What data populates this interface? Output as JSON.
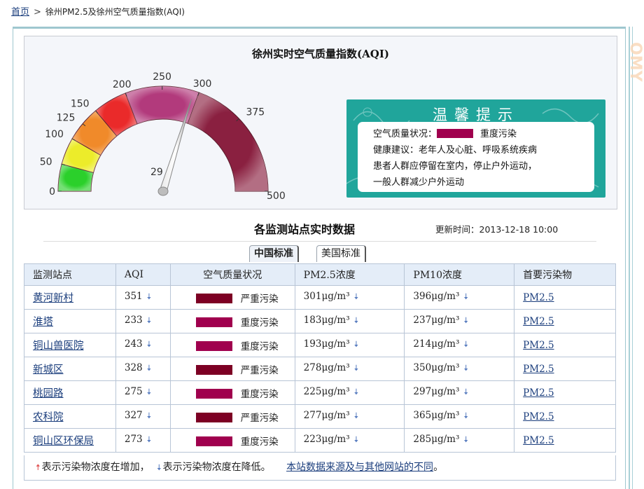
{
  "breadcrumb": {
    "home": "首页",
    "separator": ">",
    "current": "徐州PM2.5及徐州空气质量指数(AQI)"
  },
  "watermark": "OMY",
  "gauge": {
    "title": "徐州实时空气质量指数(AQI)",
    "value_label": "29",
    "needle_value": 293,
    "range": [
      0,
      500
    ],
    "tick_labels": [
      "0",
      "50",
      "100",
      "125",
      "150",
      "200",
      "250",
      "300",
      "375",
      "500"
    ],
    "bands": [
      {
        "from": 0,
        "to": 50,
        "color": "#2bd02b"
      },
      {
        "from": 50,
        "to": 100,
        "color": "#ecec2a"
      },
      {
        "from": 100,
        "to": 150,
        "color": "#f08a2a"
      },
      {
        "from": 150,
        "to": 200,
        "color": "#ea2a2a"
      },
      {
        "from": 200,
        "to": 300,
        "color": "#b23a7c"
      },
      {
        "from": 300,
        "to": 500,
        "color": "#8a2040"
      }
    ]
  },
  "tip": {
    "title": "温馨提示",
    "status_label": "空气质量状况：",
    "status_color": "#a0004e",
    "status_text": "重度污染",
    "advice_line1": "健康建议：老年人及心脏、呼吸系统疾病",
    "advice_line2": "患者人群应停留在室内，停止户外运动，",
    "advice_line3": "一般人群减少户外运动"
  },
  "stations_section": {
    "title": "各监测站点实时数据",
    "update_label": "更新时间：",
    "update_time": "2013-12-18 10:00",
    "tabs": [
      {
        "label": "中国标准",
        "active": true
      },
      {
        "label": "美国标准",
        "active": false
      }
    ],
    "columns": [
      "监测站点",
      "AQI",
      "空气质量状况",
      "PM2.5浓度",
      "PM10浓度",
      "首要污染物"
    ],
    "unit": "μg/m³",
    "colors": {
      "严重污染": "#7d0024",
      "重度污染": "#a0004e"
    },
    "rows": [
      {
        "station": "黄河新村",
        "aqi": "351",
        "status": "严重污染",
        "status_color": "#7d0024",
        "pm25": "301μg/m³",
        "pm10": "396μg/m³",
        "primary": "PM2.5"
      },
      {
        "station": "淮塔",
        "aqi": "233",
        "status": "重度污染",
        "status_color": "#a0004e",
        "pm25": "183μg/m³",
        "pm10": "237μg/m³",
        "primary": "PM2.5"
      },
      {
        "station": "铜山兽医院",
        "aqi": "243",
        "status": "重度污染",
        "status_color": "#a0004e",
        "pm25": "193μg/m³",
        "pm10": "214μg/m³",
        "primary": "PM2.5"
      },
      {
        "station": "新城区",
        "aqi": "328",
        "status": "严重污染",
        "status_color": "#7d0024",
        "pm25": "278μg/m³",
        "pm10": "350μg/m³",
        "primary": "PM2.5"
      },
      {
        "station": "桃园路",
        "aqi": "275",
        "status": "重度污染",
        "status_color": "#a0004e",
        "pm25": "225μg/m³",
        "pm10": "297μg/m³",
        "primary": "PM2.5"
      },
      {
        "station": "农科院",
        "aqi": "327",
        "status": "严重污染",
        "status_color": "#7d0024",
        "pm25": "277μg/m³",
        "pm10": "365μg/m³",
        "primary": "PM2.5"
      },
      {
        "station": "铜山区环保局",
        "aqi": "273",
        "status": "重度污染",
        "status_color": "#a0004e",
        "pm25": "223μg/m³",
        "pm10": "285μg/m³",
        "primary": "PM2.5"
      }
    ],
    "trend_icon": "arrow-down-icon",
    "legend": {
      "up_text": "表示污染物浓度在增加，",
      "down_text": "表示污染物浓度在降低。",
      "link": "本站数据来源及与其他网站的不同",
      "link_suffix": "。"
    }
  }
}
